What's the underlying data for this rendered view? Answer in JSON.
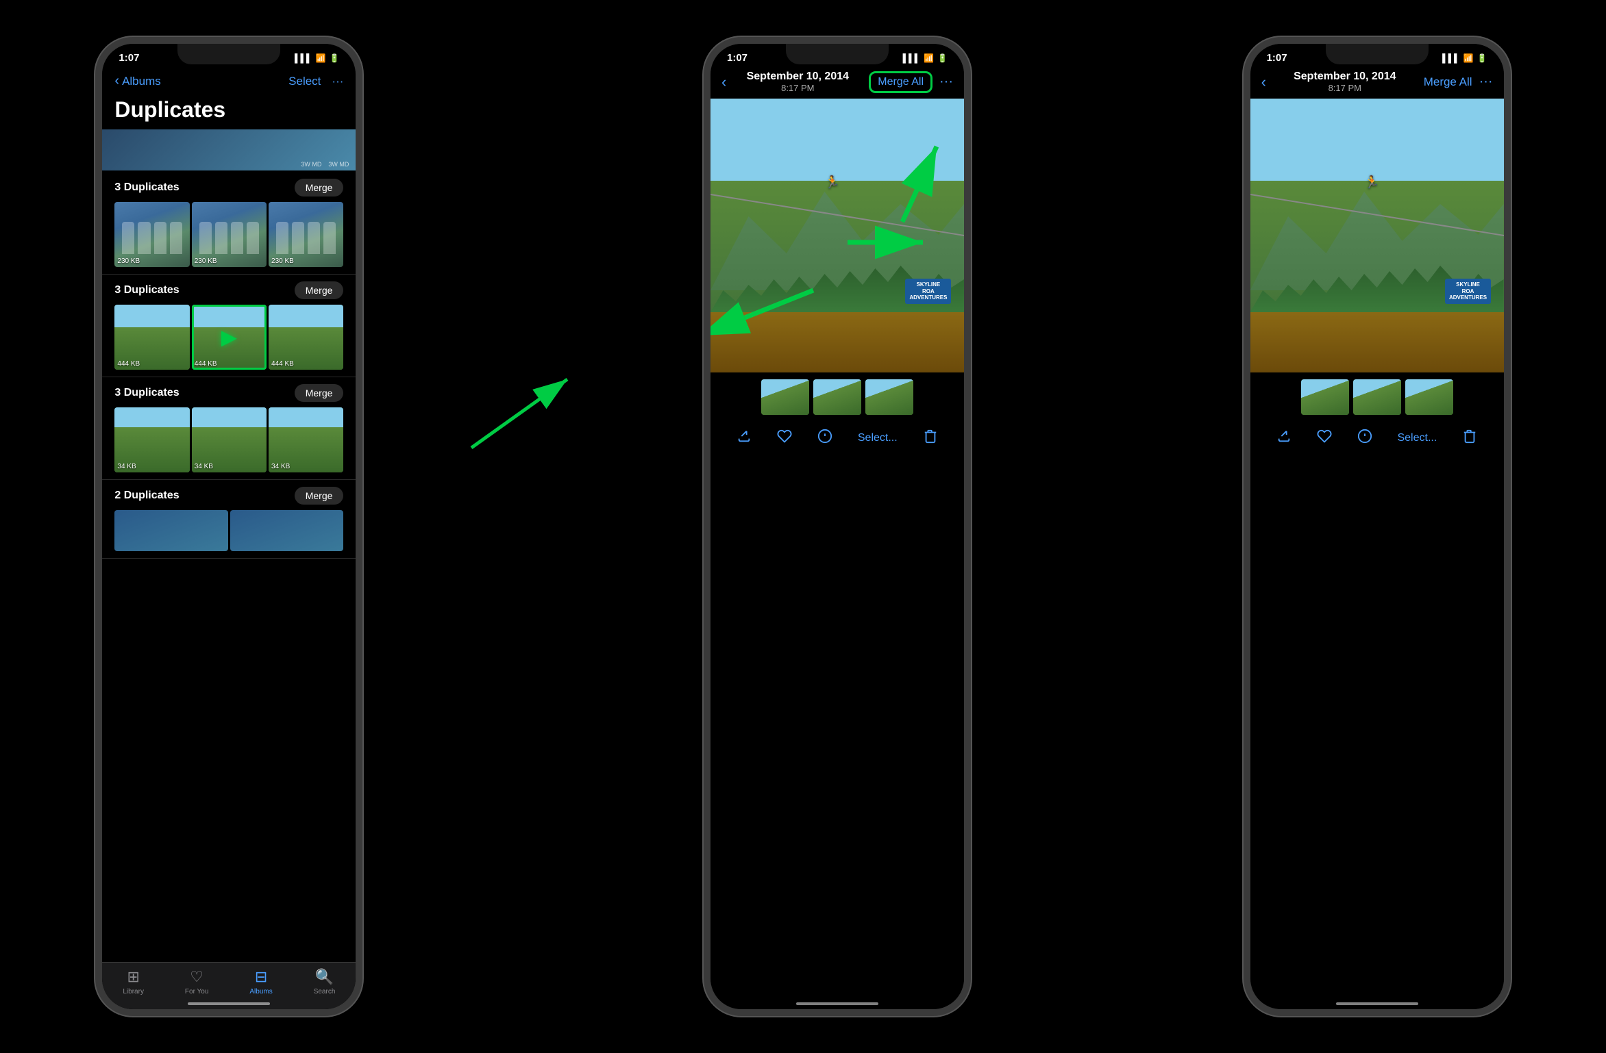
{
  "phone1": {
    "status_time": "1:07",
    "nav_back": "Albums",
    "nav_select": "Select",
    "page_title": "Duplicates",
    "groups": [
      {
        "label": "3 Duplicates",
        "merge_label": "Merge",
        "photos": [
          {
            "size": "230 KB"
          },
          {
            "size": "230 KB"
          },
          {
            "size": "230 KB"
          }
        ]
      },
      {
        "label": "3 Duplicates",
        "merge_label": "Merge",
        "highlighted": true,
        "photos": [
          {
            "size": "444 KB"
          },
          {
            "size": "444 KB",
            "highlighted": true
          },
          {
            "size": "444 KB"
          }
        ]
      },
      {
        "label": "3 Duplicates",
        "merge_label": "Merge",
        "photos": [
          {
            "size": "34 KB"
          },
          {
            "size": "34 KB"
          },
          {
            "size": "34 KB"
          }
        ]
      },
      {
        "label": "2 Duplicates",
        "merge_label": "Merge",
        "photos": []
      }
    ],
    "tabs": [
      {
        "label": "Library",
        "active": false
      },
      {
        "label": "For You",
        "active": false
      },
      {
        "label": "Albums",
        "active": true
      },
      {
        "label": "Search",
        "active": false
      }
    ]
  },
  "phone2": {
    "status_time": "1:07",
    "nav_date": "September 10, 2014",
    "nav_time": "8:17 PM",
    "merge_all_label": "Merge All",
    "more_label": "···",
    "has_green_border": true,
    "zipline_logo": "SKYLINE\nROADADVENTURES",
    "action_items": [
      {
        "label": "share",
        "icon": "↑"
      },
      {
        "label": "heart",
        "icon": "♡"
      },
      {
        "label": "info",
        "icon": "ⓘ"
      },
      {
        "label": "Select...",
        "text": true
      },
      {
        "label": "trash",
        "icon": "🗑"
      }
    ]
  },
  "phone3": {
    "status_time": "1:07",
    "nav_date": "September 10, 2014",
    "nav_time": "8:17 PM",
    "merge_all_label": "Merge All",
    "more_label": "···",
    "zipline_logo": "SKYLINE\nROADADVENTURES",
    "action_items": [
      {
        "label": "share",
        "icon": "↑"
      },
      {
        "label": "heart",
        "icon": "♡"
      },
      {
        "label": "info",
        "icon": "ⓘ"
      },
      {
        "label": "Select...",
        "text": true
      },
      {
        "label": "trash",
        "icon": "🗑"
      }
    ]
  }
}
